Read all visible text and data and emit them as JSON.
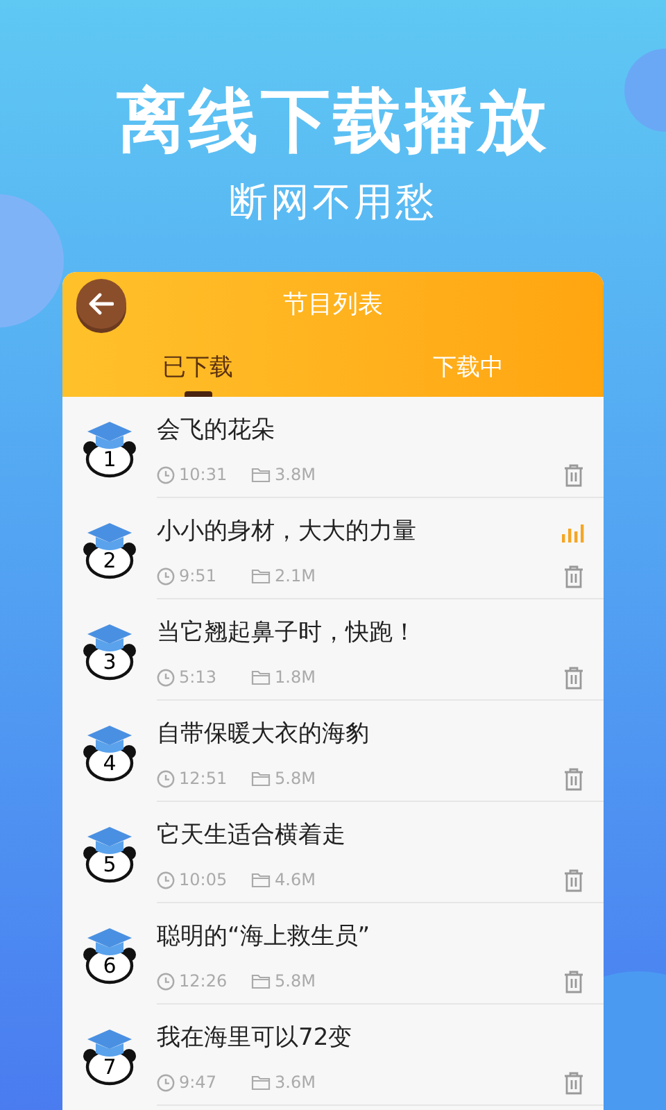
{
  "headline": "离线下载播放",
  "subheadline": "断网不用愁",
  "header": {
    "title": "节目列表"
  },
  "tabs": [
    {
      "label": "已下载",
      "selected": true
    },
    {
      "label": "下载中",
      "selected": false
    }
  ],
  "items": [
    {
      "number": "1",
      "title": "会飞的花朵",
      "duration": "10:31",
      "size": "3.8M",
      "playing": false
    },
    {
      "number": "2",
      "title": "小小的身材，大大的力量",
      "duration": "9:51",
      "size": "2.1M",
      "playing": true
    },
    {
      "number": "3",
      "title": "当它翘起鼻子时，快跑！",
      "duration": "5:13",
      "size": "1.8M",
      "playing": false
    },
    {
      "number": "4",
      "title": "自带保暖大衣的海豹",
      "duration": "12:51",
      "size": "5.8M",
      "playing": false
    },
    {
      "number": "5",
      "title": "它天生适合横着走",
      "duration": "10:05",
      "size": "4.6M",
      "playing": false
    },
    {
      "number": "6",
      "title": "聪明的“海上救生员”",
      "duration": "12:26",
      "size": "5.8M",
      "playing": false
    },
    {
      "number": "7",
      "title": "我在海里可以72变",
      "duration": "9:47",
      "size": "3.6M",
      "playing": false
    }
  ]
}
